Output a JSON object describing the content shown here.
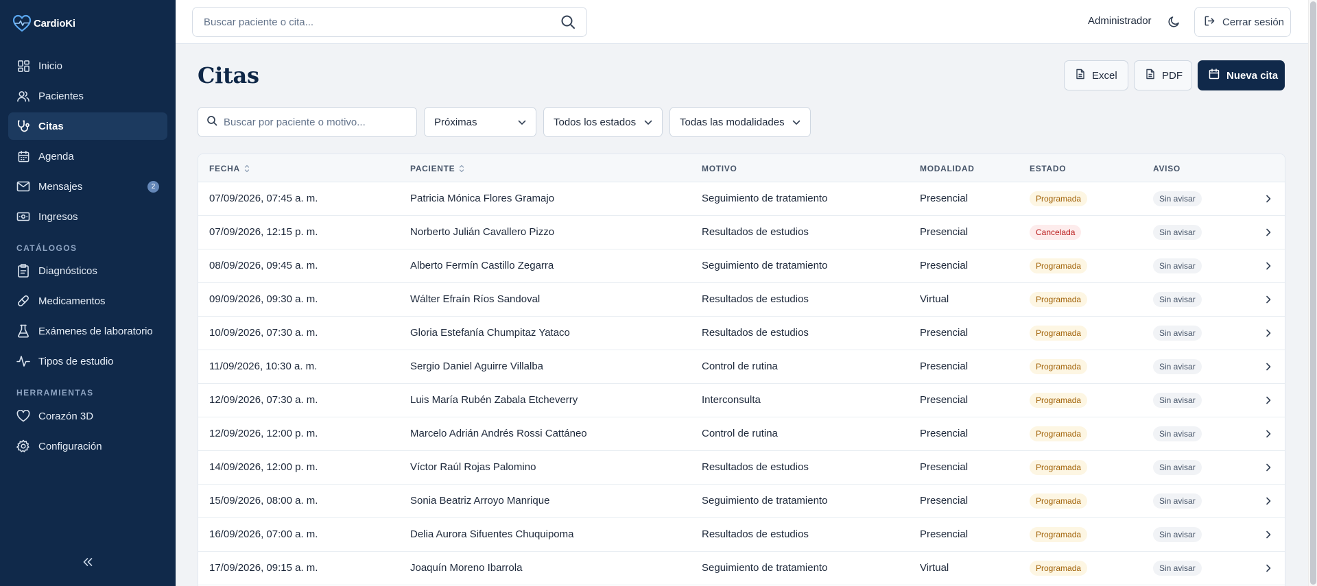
{
  "app": {
    "brand": "CardioKi"
  },
  "sidebar": {
    "items": [
      {
        "label": "Inicio",
        "icon": "dashboard-icon"
      },
      {
        "label": "Pacientes",
        "icon": "users-icon"
      },
      {
        "label": "Citas",
        "icon": "stethoscope-icon",
        "active": true
      },
      {
        "label": "Agenda",
        "icon": "calendar-icon"
      },
      {
        "label": "Mensajes",
        "icon": "mail-icon",
        "badge": "2"
      },
      {
        "label": "Ingresos",
        "icon": "banknote-icon"
      }
    ],
    "catalogs_title": "CATÁLOGOS",
    "catalogs": [
      {
        "label": "Diagnósticos",
        "icon": "clipboard-icon"
      },
      {
        "label": "Medicamentos",
        "icon": "pill-icon"
      },
      {
        "label": "Exámenes de laboratorio",
        "icon": "flask-icon"
      },
      {
        "label": "Tipos de estudio",
        "icon": "activity-icon"
      }
    ],
    "tools_title": "HERRAMIENTAS",
    "tools": [
      {
        "label": "Corazón 3D",
        "icon": "heart-icon"
      },
      {
        "label": "Configuración",
        "icon": "gear-icon"
      }
    ]
  },
  "topbar": {
    "search_placeholder": "Buscar paciente o cita...",
    "user": "Administrador",
    "logout": "Cerrar sesión"
  },
  "page": {
    "title": "Citas",
    "actions": {
      "excel": "Excel",
      "pdf": "PDF",
      "new": "Nueva cita"
    },
    "filters": {
      "search_placeholder": "Buscar por paciente o motivo...",
      "range": "Próximas",
      "status": "Todos los estados",
      "modality": "Todas las modalidades"
    }
  },
  "table": {
    "columns": [
      "FECHA",
      "PACIENTE",
      "MOTIVO",
      "MODALIDAD",
      "ESTADO",
      "AVISO"
    ],
    "rows": [
      {
        "fecha": "07/09/2026, 07:45 a. m.",
        "paciente": "Patricia Mónica Flores Gramajo",
        "motivo": "Seguimiento de tratamiento",
        "modalidad": "Presencial",
        "estado": "Programada",
        "aviso": "Sin avisar"
      },
      {
        "fecha": "07/09/2026, 12:15 p. m.",
        "paciente": "Norberto Julián Cavallero Pizzo",
        "motivo": "Resultados de estudios",
        "modalidad": "Presencial",
        "estado": "Cancelada",
        "aviso": "Sin avisar"
      },
      {
        "fecha": "08/09/2026, 09:45 a. m.",
        "paciente": "Alberto Fermín Castillo Zegarra",
        "motivo": "Seguimiento de tratamiento",
        "modalidad": "Presencial",
        "estado": "Programada",
        "aviso": "Sin avisar"
      },
      {
        "fecha": "09/09/2026, 09:30 a. m.",
        "paciente": "Wálter Efraín Ríos Sandoval",
        "motivo": "Resultados de estudios",
        "modalidad": "Virtual",
        "estado": "Programada",
        "aviso": "Sin avisar"
      },
      {
        "fecha": "10/09/2026, 07:30 a. m.",
        "paciente": "Gloria Estefanía Chumpitaz Yataco",
        "motivo": "Resultados de estudios",
        "modalidad": "Presencial",
        "estado": "Programada",
        "aviso": "Sin avisar"
      },
      {
        "fecha": "11/09/2026, 10:30 a. m.",
        "paciente": "Sergio Daniel Aguirre Villalba",
        "motivo": "Control de rutina",
        "modalidad": "Presencial",
        "estado": "Programada",
        "aviso": "Sin avisar"
      },
      {
        "fecha": "12/09/2026, 07:30 a. m.",
        "paciente": "Luis María Rubén Zabala Etcheverry",
        "motivo": "Interconsulta",
        "modalidad": "Presencial",
        "estado": "Programada",
        "aviso": "Sin avisar"
      },
      {
        "fecha": "12/09/2026, 12:00 p. m.",
        "paciente": "Marcelo Adrián Andrés Rossi Cattáneo",
        "motivo": "Control de rutina",
        "modalidad": "Presencial",
        "estado": "Programada",
        "aviso": "Sin avisar"
      },
      {
        "fecha": "14/09/2026, 12:00 p. m.",
        "paciente": "Víctor Raúl Rojas Palomino",
        "motivo": "Resultados de estudios",
        "modalidad": "Presencial",
        "estado": "Programada",
        "aviso": "Sin avisar"
      },
      {
        "fecha": "15/09/2026, 08:00 a. m.",
        "paciente": "Sonia Beatriz Arroyo Manrique",
        "motivo": "Seguimiento de tratamiento",
        "modalidad": "Presencial",
        "estado": "Programada",
        "aviso": "Sin avisar"
      },
      {
        "fecha": "16/09/2026, 07:00 a. m.",
        "paciente": "Delia Aurora Sifuentes Chuquipoma",
        "motivo": "Resultados de estudios",
        "modalidad": "Presencial",
        "estado": "Programada",
        "aviso": "Sin avisar"
      },
      {
        "fecha": "17/09/2026, 09:15 a. m.",
        "paciente": "Joaquín Moreno Ibarrola",
        "motivo": "Seguimiento de tratamiento",
        "modalidad": "Virtual",
        "estado": "Programada",
        "aviso": "Sin avisar"
      }
    ]
  },
  "colors": {
    "sidebar_bg": "#10294a",
    "primary": "#10294a",
    "scheduled_bg": "#fdf6e3",
    "scheduled_fg": "#a16207",
    "cancelled_bg": "#fdecec",
    "cancelled_fg": "#b91c1c"
  }
}
